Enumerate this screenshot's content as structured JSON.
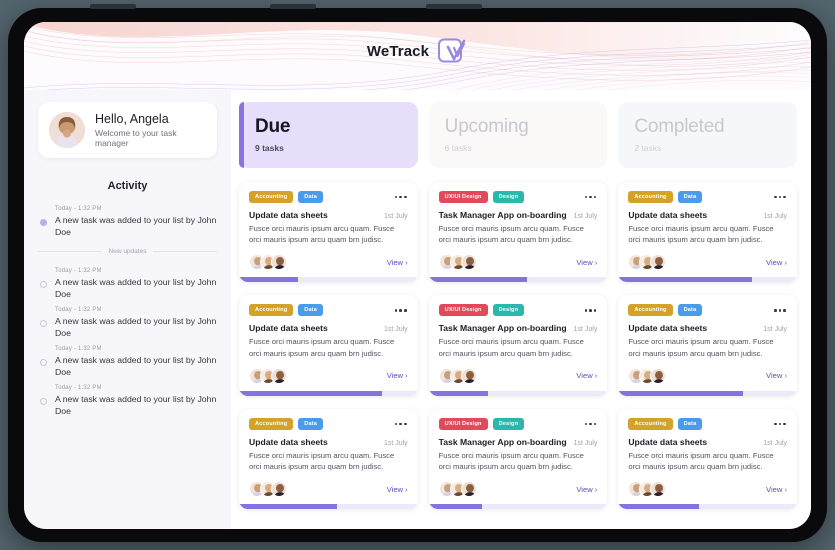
{
  "app": {
    "brand_name": "WeTrack",
    "logo_icon": "checkbox-check-icon",
    "accent_color": "#8573de",
    "header_bg": "#fdfbfd"
  },
  "sidebar": {
    "profile": {
      "avatar_icon": "user-avatar",
      "greeting": "Hello, Angela",
      "subtitle": "Welcome to your task manager"
    },
    "activity": {
      "title": "Activity",
      "divider_label": "New updates",
      "items": [
        {
          "time": "Today - 1:32 PM",
          "text": "A new task was added to your list by John Doe",
          "unread": true
        },
        {
          "time": "Today - 1:32 PM",
          "text": "A new task was added to your list by John Doe",
          "unread": false
        },
        {
          "time": "Today - 1:32 PM",
          "text": "A new task was added to your list by John Doe",
          "unread": false
        },
        {
          "time": "Today - 1:32 PM",
          "text": "A new task was added to your list by John Doe",
          "unread": false
        },
        {
          "time": "Today - 1:32 PM",
          "text": "A new task was added to your list by John Doe",
          "unread": false
        }
      ]
    }
  },
  "board": {
    "columns": [
      {
        "title": "Due",
        "count_label": "9 tasks",
        "state": "active",
        "cards": [
          {
            "tags": [
              {
                "label": "Accounting",
                "color": "#d4a229"
              },
              {
                "label": "Data",
                "color": "#4a9bea"
              }
            ],
            "title": "Update data sheets",
            "date": "1st July",
            "description": "Fusce orci mauris ipsum arcu quam. Fusce orci mauris ipsum arcu quam brn judisc.",
            "view_label": "View ›",
            "menu_icon": "more-horizontal-icon",
            "progress": 33
          },
          {
            "tags": [
              {
                "label": "Accounting",
                "color": "#d4a229"
              },
              {
                "label": "Data",
                "color": "#4a9bea"
              }
            ],
            "title": "Update data sheets",
            "date": "1st July",
            "description": "Fusce orci mauris ipsum arcu quam. Fusce orci mauris ipsum arcu quam brn judisc.",
            "view_label": "View ›",
            "menu_icon": "more-horizontal-icon",
            "progress": 80
          },
          {
            "tags": [
              {
                "label": "Accounting",
                "color": "#d4a229"
              },
              {
                "label": "Data",
                "color": "#4a9bea"
              }
            ],
            "title": "Update data sheets",
            "date": "1st July",
            "description": "Fusce orci mauris ipsum arcu quam. Fusce orci mauris ipsum arcu quam brn judisc.",
            "view_label": "View ›",
            "menu_icon": "more-horizontal-icon",
            "progress": 55
          }
        ]
      },
      {
        "title": "Upcoming",
        "count_label": "6 tasks",
        "state": "muted",
        "cards": [
          {
            "tags": [
              {
                "label": "UX/UI Design",
                "color": "#e2495a"
              },
              {
                "label": "Design",
                "color": "#2ab8ad"
              }
            ],
            "title": "Task Manager App on-boarding",
            "date": "1st July",
            "description": "Fusce orci mauris ipsum arcu quam. Fusce orci mauris ipsum arcu quam brn judisc.",
            "view_label": "View ›",
            "menu_icon": "more-horizontal-icon",
            "progress": 55
          },
          {
            "tags": [
              {
                "label": "UX/UI Design",
                "color": "#e2495a"
              },
              {
                "label": "Design",
                "color": "#2ab8ad"
              }
            ],
            "title": "Task Manager App on-boarding",
            "date": "1st July",
            "description": "Fusce orci mauris ipsum arcu quam. Fusce orci mauris ipsum arcu quam brn judisc.",
            "view_label": "View ›",
            "menu_icon": "more-horizontal-icon",
            "progress": 33
          },
          {
            "tags": [
              {
                "label": "UX/UI Design",
                "color": "#e2495a"
              },
              {
                "label": "Design",
                "color": "#2ab8ad"
              }
            ],
            "title": "Task Manager App on-boarding",
            "date": "1st July",
            "description": "Fusce orci mauris ipsum arcu quam. Fusce orci mauris ipsum arcu quam brn judisc.",
            "view_label": "View ›",
            "menu_icon": "more-horizontal-icon",
            "progress": 30
          }
        ]
      },
      {
        "title": "Completed",
        "count_label": "2 tasks",
        "state": "muted2",
        "cards": [
          {
            "tags": [
              {
                "label": "Accounting",
                "color": "#d4a229"
              },
              {
                "label": "Data",
                "color": "#4a9bea"
              }
            ],
            "title": "Update data sheets",
            "date": "1st July",
            "description": "Fusce orci mauris ipsum arcu quam. Fusce orci mauris ipsum arcu quam brn judisc.",
            "view_label": "View ›",
            "menu_icon": "more-horizontal-icon",
            "progress": 75
          },
          {
            "tags": [
              {
                "label": "Accounting",
                "color": "#d4a229"
              },
              {
                "label": "Data",
                "color": "#4a9bea"
              }
            ],
            "title": "Update data sheets",
            "date": "1st July",
            "description": "Fusce orci mauris ipsum arcu quam. Fusce orci mauris ipsum arcu quam brn judisc.",
            "view_label": "View ›",
            "menu_icon": "more-horizontal-icon",
            "progress": 70
          },
          {
            "tags": [
              {
                "label": "Accounting",
                "color": "#d4a229"
              },
              {
                "label": "Data",
                "color": "#4a9bea"
              }
            ],
            "title": "Update data sheets",
            "date": "1st July",
            "description": "Fusce orci mauris ipsum arcu quam. Fusce orci mauris ipsum arcu quam brn judisc.",
            "view_label": "View ›",
            "menu_icon": "more-horizontal-icon",
            "progress": 45
          }
        ]
      }
    ]
  }
}
